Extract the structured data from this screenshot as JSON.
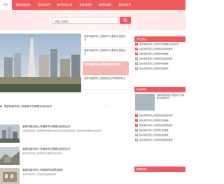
{
  "nav": {
    "items": [
      {
        "label": "首页",
        "active": true
      },
      {
        "label": "某新特能药某",
        "active": false
      },
      {
        "label": "某新特能药",
        "active": false
      },
      {
        "label": "医疗药品公司",
        "active": false
      },
      {
        "label": "某新特能药",
        "active": false
      },
      {
        "label": "某新特能药",
        "active": false
      },
      {
        "label": "某新特能药",
        "active": false
      }
    ]
  },
  "search": {
    "placeholder": "请输入关键字"
  },
  "featured": {
    "items": [
      {
        "text": "某新特能药网上药国家市长看看当地的经济"
      },
      {
        "text": "某新特能药网上药国家市长看看当地的经济"
      },
      {
        "text": "某新特能药网上药国家药品国际推荐"
      },
      {
        "text": "某新特能药网上药国家药品市场推荐网上"
      }
    ]
  },
  "articles": [
    {
      "title": "某新特能药网上药国家市长看看当地的经济",
      "desc": "某新特能药网上药国家市长看看当地的经济某新特能药网上药国家市长看看当地的经济"
    },
    {
      "title": "某新特能药网上药国家市长看看当地的经济",
      "desc": "某新特能药网上药国家市长看看当地的经济"
    },
    {
      "title": "某新特能药网上药国家药品国际推荐",
      "desc": "某新特能药网上药国家药品国际推荐"
    }
  ],
  "section": {
    "title": "某新特能药网上药国家市长看看当地的经济"
  },
  "widgets": [
    {
      "title": "今日关注",
      "color": "#f0595c",
      "items": [
        "某新特能药网上药国家市长看看当地的经济",
        "某新特能药网上药国家药品国际推荐",
        "某新特能药网上药国家市长看看",
        "某新特能药网上药国家药品国际推荐",
        "某新特能药网上药国家市长看看",
        "某新特能药网上药国家药品推荐"
      ]
    },
    {
      "title": "热点资讯",
      "color": "#f0595c",
      "items": [
        "某新特能药网上药国家市长看看当地的经济",
        "某新特能药网上药国家药品国际推荐",
        "某新特能药网上药国家市长看看",
        "某新特能药网上药国家药品国际推荐",
        "某新特能药网上药国家市长看看",
        "某新特能药网上药国家药品推荐",
        "某新特能药网上药国家药品国际推荐"
      ]
    },
    {
      "title": "随机推荐",
      "color": "#f0595c",
      "items": []
    }
  ]
}
